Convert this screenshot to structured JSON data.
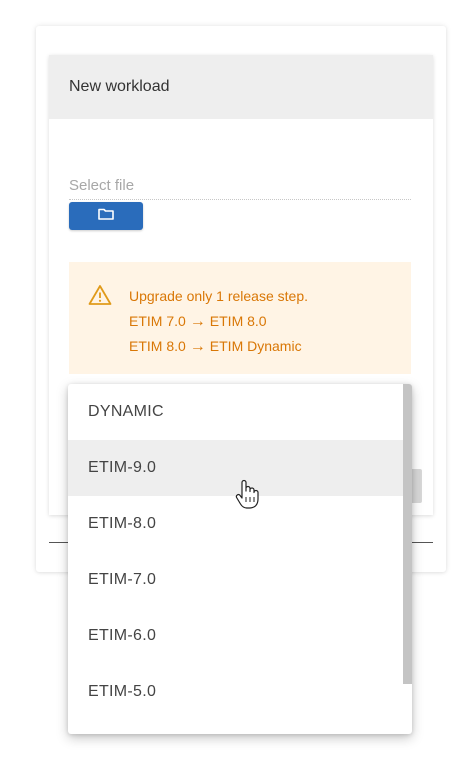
{
  "dialog": {
    "title": "New workload",
    "file_label": "Select file",
    "folder_icon": "folder-icon"
  },
  "warning": {
    "icon": "warning-triangle-icon",
    "line1": "Upgrade only 1 release step.",
    "line2_from": "ETIM 7.0",
    "line2_to": "ETIM 8.0",
    "line3_from": "ETIM 8.0",
    "line3_to": "ETIM Dynamic",
    "arrow": "→"
  },
  "dropdown": {
    "options": [
      "DYNAMIC",
      "ETIM-9.0",
      "ETIM-8.0",
      "ETIM-7.0",
      "ETIM-6.0",
      "ETIM-5.0"
    ],
    "highlighted": "ETIM-9.0"
  },
  "colors": {
    "primary": "#2a6cbb",
    "warning_text": "#d97706",
    "warning_bg": "#fff4e5"
  }
}
